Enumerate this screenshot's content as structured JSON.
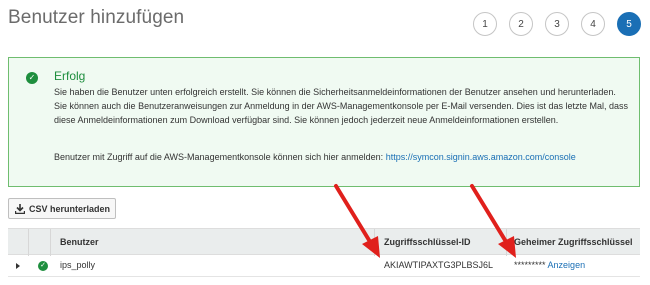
{
  "page": {
    "title": "Benutzer hinzufügen"
  },
  "steps": [
    "1",
    "2",
    "3",
    "4",
    "5"
  ],
  "alert": {
    "title": "Erfolg",
    "body": "Sie haben die Benutzer unten erfolgreich erstellt. Sie können die Sicherheitsanmeldeinformationen der Benutzer ansehen und herunterladen. Sie können auch die Benutzeranweisungen zur Anmeldung in der AWS-Managementkonsole per E-Mail versenden. Dies ist das letzte Mal, dass diese Anmeldeinformationen zum Download verfügbar sind. Sie können jedoch jederzeit neue Anmeldeinformationen erstellen.",
    "console_text": "Benutzer mit Zugriff auf die AWS-Managementkonsole können sich hier anmelden: ",
    "console_link": "https://symcon.signin.aws.amazon.com/console"
  },
  "toolbar": {
    "csv_label": "CSV herunterladen"
  },
  "table": {
    "columns": {
      "user": "Benutzer",
      "access_key_id": "Zugriffsschlüssel-ID",
      "secret_key": "Geheimer Zugriffsschlüssel"
    },
    "rows": [
      {
        "user": "ips_polly",
        "access_key_id": "AKIAWTIPAXTG3PLBSJ6L",
        "secret_masked": "*********",
        "show_label": "Anzeigen"
      }
    ]
  },
  "icons": {
    "success": "check-circle-icon",
    "download": "download-icon",
    "expand": "caret-right-icon"
  },
  "colors": {
    "accent": "#1a6fb5",
    "success": "#1e8e3e",
    "arrow": "#e0201c"
  }
}
